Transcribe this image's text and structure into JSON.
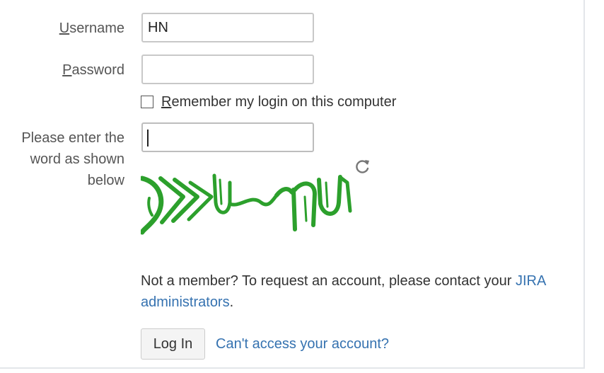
{
  "form": {
    "username": {
      "label_mnemonic": "U",
      "label_rest": "sername",
      "value": ""
    },
    "password": {
      "label_mnemonic": "P",
      "label_rest": "assword",
      "value": ""
    },
    "remember": {
      "label_mnemonic": "R",
      "label_rest": "emember my login on this computer",
      "checked": false
    },
    "captcha": {
      "label_line1": "Please enter the",
      "label_line2": "word as shown",
      "label_line3": "below",
      "value": "",
      "image_color": "#2ca02c",
      "refresh_icon": "refresh-icon"
    }
  },
  "username_value": "HN",
  "request_account": {
    "text": "Not a member? To request an account, please contact your ",
    "link_text_1": "JIRA",
    "link_text_2": "administrators",
    "suffix": "."
  },
  "actions": {
    "login_label": "Log In",
    "forgot_label": "Can't access your account?"
  },
  "colors": {
    "link": "#3572b0",
    "label": "#555555",
    "border": "#c8c8c8"
  }
}
